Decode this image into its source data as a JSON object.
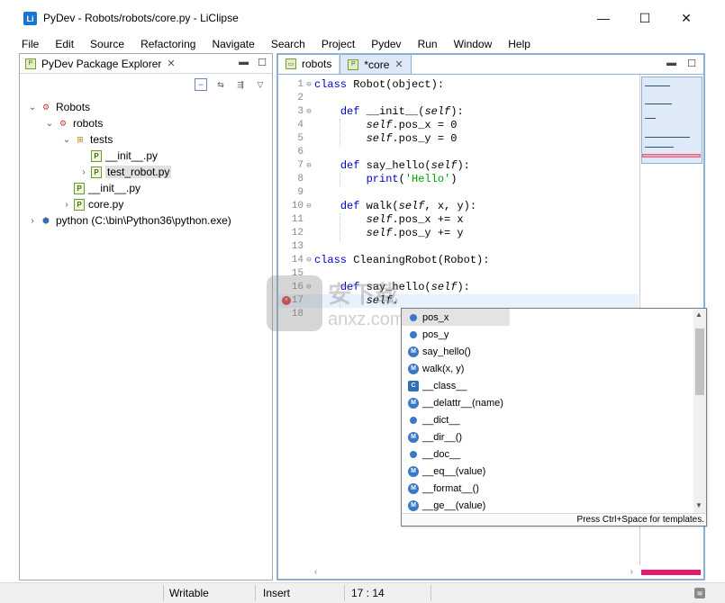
{
  "window": {
    "title": "PyDev - Robots/robots/core.py - LiClipse",
    "logo_text": "Li",
    "minimize": "—",
    "maximize": "☐",
    "close": "✕"
  },
  "menu": [
    "File",
    "Edit",
    "Source",
    "Refactoring",
    "Navigate",
    "Search",
    "Project",
    "Pydev",
    "Run",
    "Window",
    "Help"
  ],
  "package_explorer": {
    "tab_label": "PyDev Package Explorer",
    "tree": [
      {
        "label": "Robots",
        "level": 0,
        "arrow": "⌄",
        "icon": "project"
      },
      {
        "label": "robots",
        "level": 1,
        "arrow": "⌄",
        "icon": "project"
      },
      {
        "label": "tests",
        "level": 2,
        "arrow": "⌄",
        "icon": "package"
      },
      {
        "label": "__init__.py",
        "level": 3,
        "arrow": "",
        "icon": "file"
      },
      {
        "label": "test_robot.py",
        "level": 3,
        "arrow": "›",
        "icon": "file",
        "selected": true
      },
      {
        "label": "__init__.py",
        "level": 2,
        "arrow": "",
        "icon": "file"
      },
      {
        "label": "core.py",
        "level": 2,
        "arrow": "›",
        "icon": "file"
      },
      {
        "label": "python  (C:\\bin\\Python36\\python.exe)",
        "level": 0,
        "arrow": "›",
        "icon": "python"
      }
    ]
  },
  "editor": {
    "tabs": [
      {
        "label": "robots",
        "active": false
      },
      {
        "label": "*core",
        "active": true
      }
    ],
    "cursor_line": 17,
    "lines": [
      {
        "n": "1",
        "fold": "⊖",
        "html": "<span class='kw'>class</span> Robot(object):"
      },
      {
        "n": "2",
        "fold": "",
        "html": ""
      },
      {
        "n": "3",
        "fold": "⊖",
        "html": "    <span class='kw'>def</span> __init__(<span class='slf'>self</span>):"
      },
      {
        "n": "4",
        "fold": "",
        "html": "        <span class='slf'>self</span>.pos_x = 0"
      },
      {
        "n": "5",
        "fold": "",
        "html": "        <span class='slf'>self</span>.pos_y = 0"
      },
      {
        "n": "6",
        "fold": "",
        "html": ""
      },
      {
        "n": "7",
        "fold": "⊖",
        "html": "    <span class='kw'>def</span> say_hello(<span class='slf'>self</span>):"
      },
      {
        "n": "8",
        "fold": "",
        "html": "        <span class='kw'>print</span>(<span class='str'>'Hello'</span>)"
      },
      {
        "n": "9",
        "fold": "",
        "html": ""
      },
      {
        "n": "10",
        "fold": "⊖",
        "html": "    <span class='kw'>def</span> walk(<span class='slf'>self</span>, x, y):"
      },
      {
        "n": "11",
        "fold": "",
        "html": "        <span class='slf'>self</span>.pos_x += x"
      },
      {
        "n": "12",
        "fold": "",
        "html": "        <span class='slf'>self</span>.pos_y += y"
      },
      {
        "n": "13",
        "fold": "",
        "html": ""
      },
      {
        "n": "14",
        "fold": "⊖",
        "html": "<span class='kw'>class</span> CleaningRobot(Robot):"
      },
      {
        "n": "15",
        "fold": "",
        "html": ""
      },
      {
        "n": "16",
        "fold": "⊖",
        "html": "    <span class='kw'>def</span> say_hello(<span class='slf'>self</span>):"
      },
      {
        "n": "17",
        "fold": "",
        "html": "        <span class='slf'>self</span>."
      },
      {
        "n": "18",
        "fold": "",
        "html": ""
      }
    ]
  },
  "autocomplete": {
    "items": [
      {
        "label": "pos_x",
        "kind": "field",
        "selected": true
      },
      {
        "label": "pos_y",
        "kind": "field"
      },
      {
        "label": "say_hello()",
        "kind": "method"
      },
      {
        "label": "walk(x, y)",
        "kind": "method"
      },
      {
        "label": "__class__",
        "kind": "class"
      },
      {
        "label": "__delattr__(name)",
        "kind": "method"
      },
      {
        "label": "__dict__",
        "kind": "field"
      },
      {
        "label": "__dir__()",
        "kind": "method"
      },
      {
        "label": "__doc__",
        "kind": "field"
      },
      {
        "label": "__eq__(value)",
        "kind": "method"
      },
      {
        "label": "__format__()",
        "kind": "method"
      },
      {
        "label": "__ge__(value)",
        "kind": "method"
      }
    ],
    "footer": "Press Ctrl+Space for templates."
  },
  "status": {
    "writable": "Writable",
    "insert": "Insert",
    "position": "17 : 14"
  },
  "watermark": {
    "cn": "安下载",
    "url": "anxz.com"
  }
}
